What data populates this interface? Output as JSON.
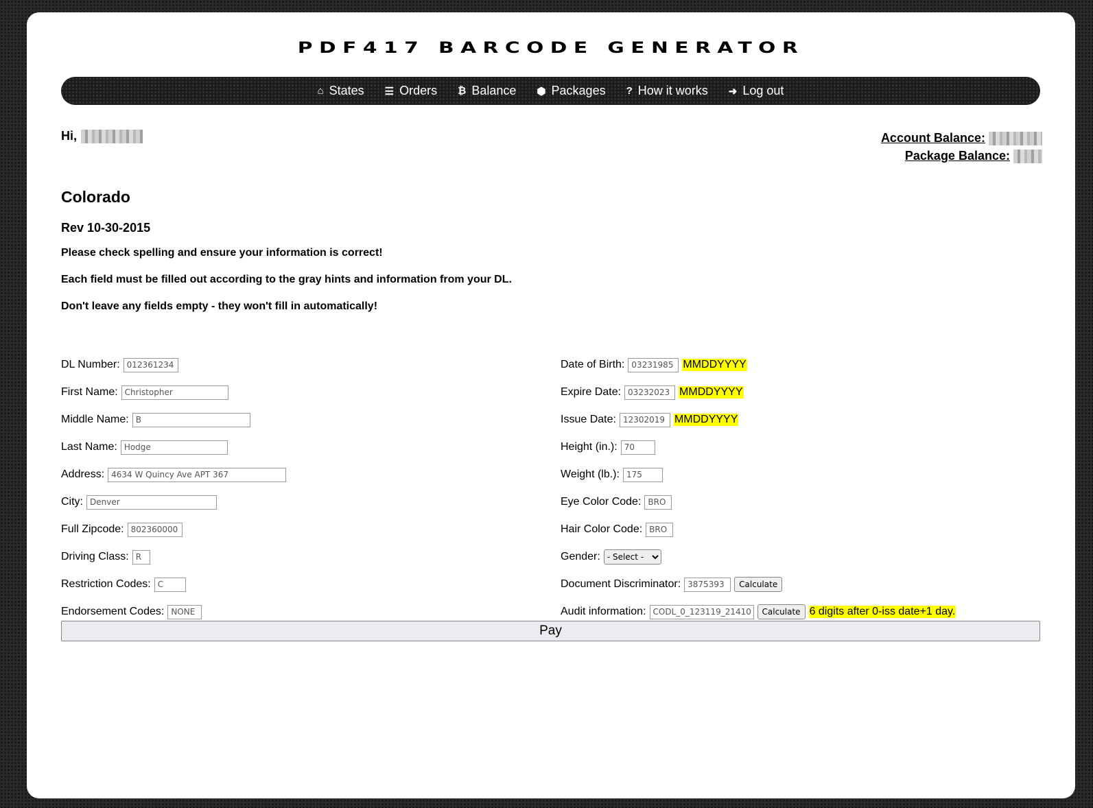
{
  "header": {
    "title": "PDF417 BARCODE GENERATOR"
  },
  "nav": [
    {
      "icon": "home-icon",
      "glyph": "⌂",
      "label": "States"
    },
    {
      "icon": "list-icon",
      "glyph": "☰",
      "label": "Orders"
    },
    {
      "icon": "bitcoin-icon",
      "glyph": "₿",
      "label": "Balance"
    },
    {
      "icon": "package-icon",
      "glyph": "⬢",
      "label": "Packages"
    },
    {
      "icon": "question-icon",
      "glyph": "?",
      "label": "How it works"
    },
    {
      "icon": "logout-icon",
      "glyph": "➜",
      "label": "Log out"
    }
  ],
  "user": {
    "greeting": "Hi,"
  },
  "balances": {
    "account_label": "Account Balance:",
    "package_label": "Package Balance:"
  },
  "state": {
    "name": "Colorado",
    "revision": "Rev 10-30-2015"
  },
  "notes": [
    "Please check spelling and ensure your information is correct!",
    "Each field must be filled out according to the gray hints and information from your DL.",
    "Don't leave any fields empty - they won't fill in automatically!"
  ],
  "left_fields": [
    {
      "label": "DL Number:",
      "placeholder": "012361234"
    },
    {
      "label": "First Name:",
      "placeholder": "Christopher"
    },
    {
      "label": "Middle Name:",
      "placeholder": "B"
    },
    {
      "label": "Last Name:",
      "placeholder": "Hodge"
    },
    {
      "label": "Address:",
      "placeholder": "4634 W Quincy Ave APT 367"
    },
    {
      "label": "City:",
      "placeholder": "Denver"
    },
    {
      "label": "Full Zipcode:",
      "placeholder": "802360000"
    },
    {
      "label": "Driving Class:",
      "placeholder": "R"
    },
    {
      "label": "Restriction Codes:",
      "placeholder": "C"
    },
    {
      "label": "Endorsement Codes:",
      "placeholder": "NONE"
    }
  ],
  "right_fields": {
    "dob": {
      "label": "Date of Birth:",
      "placeholder": "03231985",
      "hint": "MMDDYYYY"
    },
    "expire": {
      "label": "Expire Date:",
      "placeholder": "03232023",
      "hint": "MMDDYYYY"
    },
    "issue": {
      "label": "Issue Date:",
      "placeholder": "12302019",
      "hint": "MMDDYYYY"
    },
    "height": {
      "label": "Height (in.):",
      "placeholder": "70"
    },
    "weight": {
      "label": "Weight (lb.):",
      "placeholder": "175"
    },
    "eye": {
      "label": "Eye Color Code:",
      "placeholder": "BRO"
    },
    "hair": {
      "label": "Hair Color Code:",
      "placeholder": "BRO"
    },
    "gender": {
      "label": "Gender:",
      "selected": "- Select -"
    },
    "discriminator": {
      "label": "Document Discriminator:",
      "placeholder": "3875393",
      "button": "Calculate"
    },
    "audit": {
      "label": "Audit information:",
      "placeholder": "CODL_0_123119_21410",
      "button": "Calculate",
      "hint": "6 digits after 0-iss date+1 day."
    }
  },
  "actions": {
    "pay": "Pay"
  },
  "colors": {
    "hint_bg": "#ffff00",
    "nav_bg": "#1c1c1c"
  }
}
